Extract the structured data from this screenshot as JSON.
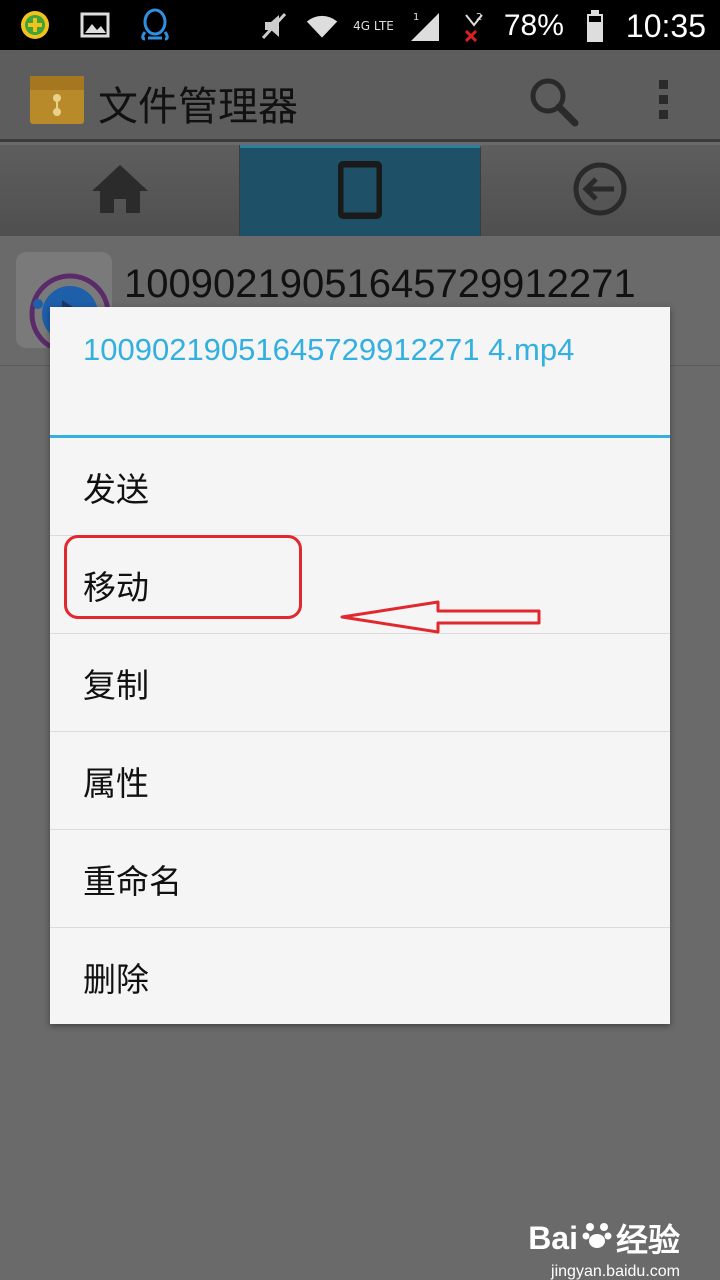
{
  "status_bar": {
    "network_label": "4G LTE",
    "sim1_label": "1",
    "sim2_label": "2",
    "battery": "78%",
    "time": "10:35"
  },
  "action_bar": {
    "title": "文件管理器",
    "icons": [
      "app-folder-icon",
      "search-icon",
      "overflow-menu-icon"
    ]
  },
  "tabs": [
    {
      "icon": "home-icon",
      "active": false
    },
    {
      "icon": "phone-device-icon",
      "active": true
    },
    {
      "icon": "back-arrow-icon",
      "active": false
    }
  ],
  "file_list": {
    "items": [
      {
        "name": "10090219051645729912271",
        "icon": "video-play-icon"
      }
    ]
  },
  "dialog": {
    "title": "10090219051645729912271 4.mp4",
    "items": [
      "发送",
      "移动",
      "复制",
      "属性",
      "重命名",
      "删除"
    ]
  },
  "watermark": {
    "brand": "Bai",
    "brand_suffix": "经验",
    "url": "jingyan.baidu.com"
  },
  "colors": {
    "accent": "#33b0e0",
    "annotation": "#e0282e",
    "active_tab": "#1e5167"
  }
}
